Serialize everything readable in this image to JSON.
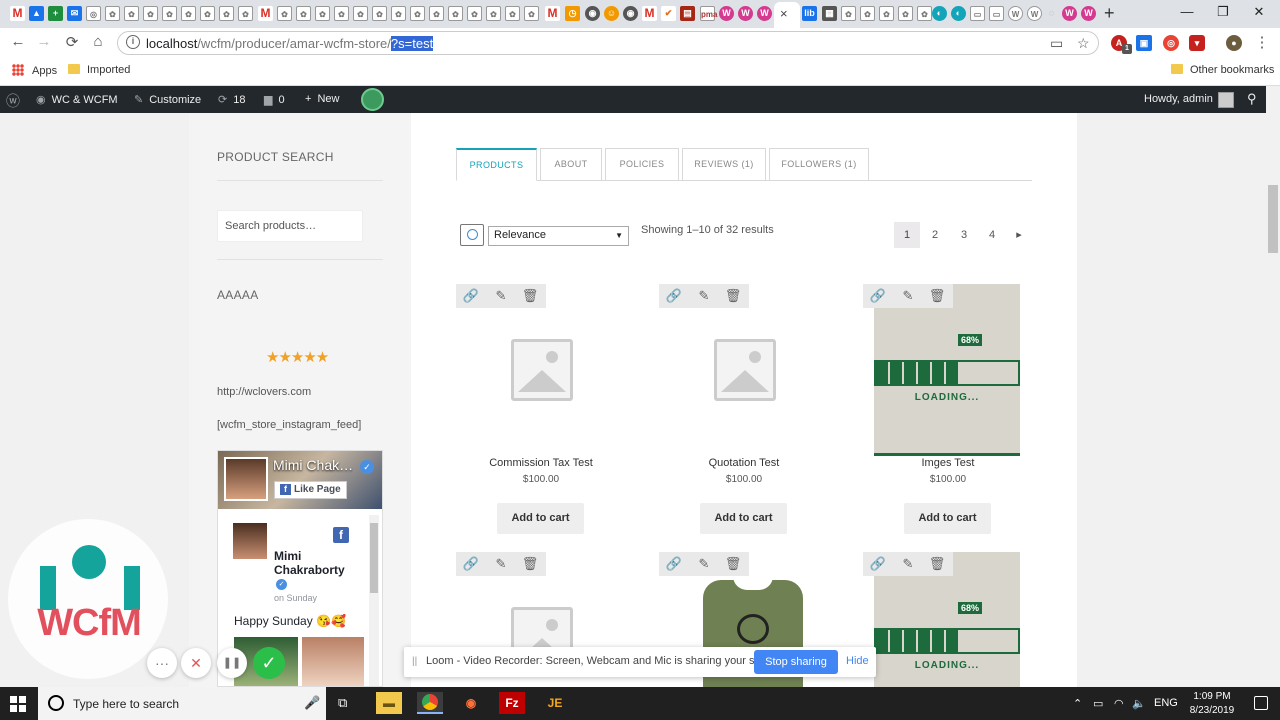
{
  "browser": {
    "tabs": {
      "close": "×",
      "new": "+"
    },
    "window_controls": {
      "minimize": "—",
      "maximize": "❐",
      "close": "✕"
    },
    "nav": {
      "back": "←",
      "forward": "→",
      "reload": "⟳",
      "home": "⌂"
    },
    "url": {
      "host": "localhost",
      "path": "/wcfm/producer/amar-wcfm-store/",
      "query": "?s=test"
    },
    "bookmarks": [
      {
        "label": "Apps"
      },
      {
        "label": "Imported"
      },
      {
        "label": "Other bookmarks"
      }
    ],
    "extensions": {
      "badge": "1"
    }
  },
  "adminbar": {
    "site_name": "WC & WCFM",
    "customize": "Customize",
    "updates": "18",
    "comments": "0",
    "new": "New",
    "howdy": "Howdy, admin"
  },
  "sidebar": {
    "product_search_heading": "PRODUCT SEARCH",
    "search_placeholder": "Search products…",
    "store_heading": "AAAAA",
    "rating_stars": "★★★★★",
    "rating_value": 5,
    "website": "http://wclovers.com",
    "instagram_shortcode": "[wcfm_store_instagram_feed]",
    "facebook": {
      "page_name": "Mimi Chakraborty",
      "like_label": "Like Page",
      "post_author": "Mimi Chakraborty",
      "post_time": "on Sunday",
      "post_message": "Happy Sunday 😘🥰"
    }
  },
  "store": {
    "tabs": [
      {
        "label": "PRODUCTS",
        "active": true
      },
      {
        "label": "ABOUT"
      },
      {
        "label": "POLICIES"
      },
      {
        "label": "REVIEWS (1)"
      },
      {
        "label": "FOLLOWERS (1)"
      }
    ],
    "orderby": "Relevance",
    "result_count": "Showing 1–10 of 32 results",
    "pagination": [
      "1",
      "2",
      "3",
      "4",
      "▸"
    ],
    "current_page": "1"
  },
  "products": [
    {
      "title": "Commission Tax Test",
      "price": "$100.00",
      "button": "Add to cart",
      "image": "placeholder"
    },
    {
      "title": "Quotation Test",
      "price": "$100.00",
      "button": "Add to cart",
      "image": "placeholder"
    },
    {
      "title": "Imges Test",
      "price": "$100.00",
      "button": "Add to cart",
      "image": "loading",
      "loading_pct": "68%",
      "loading_text": "LOADING..."
    },
    {
      "title": "",
      "price": "",
      "button": "",
      "image": "placeholder"
    },
    {
      "title": "",
      "price": "",
      "button": "",
      "image": "tshirt"
    },
    {
      "title": "",
      "price": "",
      "button": "",
      "image": "loading",
      "loading_pct": "68%",
      "loading_text": "LOADING..."
    }
  ],
  "overlay": {
    "wcfm_logo_text": "WCfM",
    "loom_controls": [
      "···",
      "✕",
      "❚❚",
      "✓"
    ]
  },
  "sharing_bar": {
    "grip": "||",
    "message": "Loom - Video Recorder: Screen, Webcam and Mic is sharing your screen.",
    "stop": "Stop sharing",
    "hide": "Hide"
  },
  "taskbar": {
    "search_placeholder": "Type here to search",
    "tray": {
      "lang": "ENG",
      "time": "1:09 PM",
      "date": "8/23/2019"
    }
  },
  "colors": {
    "accent": "#17a2b8",
    "admin_bar": "#23282d",
    "stars": "#f0a127",
    "loom_blue": "#4285f4"
  }
}
